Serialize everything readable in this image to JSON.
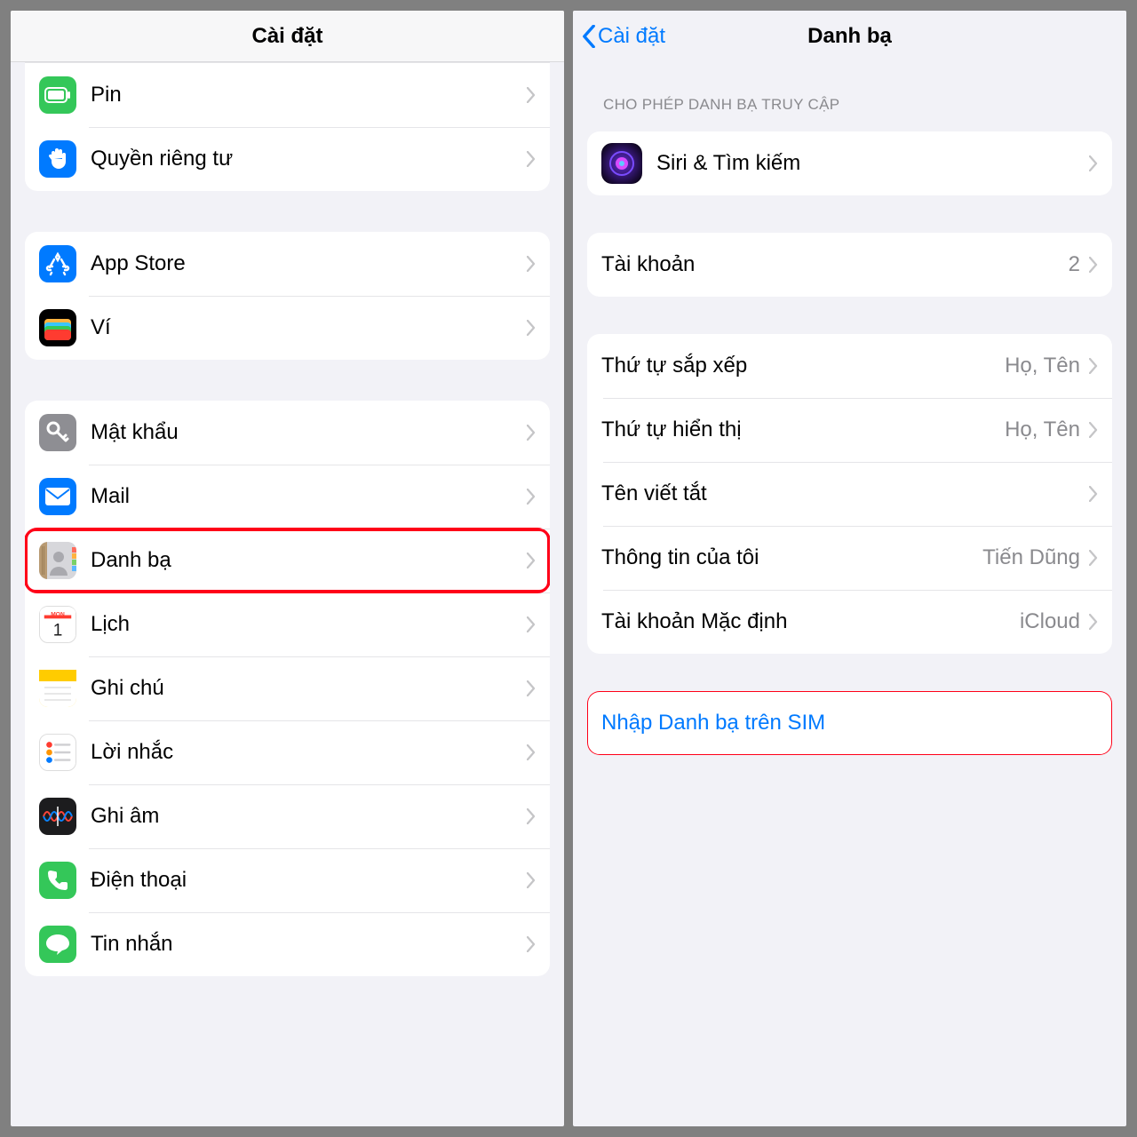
{
  "left": {
    "title": "Cài đặt",
    "groups": [
      {
        "partial": true,
        "items": [
          {
            "key": "battery",
            "icon": "battery-icon",
            "bg": "bg-green",
            "label": "Pin"
          },
          {
            "key": "privacy",
            "icon": "hand-icon",
            "bg": "bg-blue",
            "label": "Quyền riêng tư"
          }
        ]
      },
      {
        "items": [
          {
            "key": "appstore",
            "icon": "appstore-icon",
            "bg": "bg-blue",
            "label": "App Store"
          },
          {
            "key": "wallet",
            "icon": "wallet-icon",
            "bg": "bg-wallet",
            "label": "Ví"
          }
        ]
      },
      {
        "items": [
          {
            "key": "passwords",
            "icon": "key-icon",
            "bg": "bg-gray",
            "label": "Mật khẩu"
          },
          {
            "key": "mail",
            "icon": "mail-icon",
            "bg": "bg-blue",
            "label": "Mail"
          },
          {
            "key": "contacts",
            "icon": "contacts-icon",
            "bg": "bg-contacts",
            "label": "Danh bạ",
            "highlight": true
          },
          {
            "key": "calendar",
            "icon": "calendar-icon",
            "bg": "bg-white-border",
            "label": "Lịch"
          },
          {
            "key": "notes",
            "icon": "notes-icon",
            "bg": "bg-yellow-grad",
            "label": "Ghi chú"
          },
          {
            "key": "reminders",
            "icon": "reminders-icon",
            "bg": "bg-white-border",
            "label": "Lời nhắc"
          },
          {
            "key": "voice",
            "icon": "voice-memos-icon",
            "bg": "bg-dark",
            "label": "Ghi âm"
          },
          {
            "key": "phone",
            "icon": "phone-icon",
            "bg": "bg-green",
            "label": "Điện thoại"
          },
          {
            "key": "messages",
            "icon": "messages-icon",
            "bg": "bg-green",
            "label": "Tin nhắn"
          }
        ]
      }
    ]
  },
  "right": {
    "back": "Cài đặt",
    "title": "Danh bạ",
    "section_header": "CHO PHÉP DANH BẠ TRUY CẬP",
    "siri_label": "Siri & Tìm kiếm",
    "accounts": {
      "label": "Tài khoản",
      "value": "2"
    },
    "prefs": [
      {
        "label": "Thứ tự sắp xếp",
        "value": "Họ, Tên"
      },
      {
        "label": "Thứ tự hiển thị",
        "value": "Họ, Tên"
      },
      {
        "label": "Tên viết tắt",
        "value": ""
      },
      {
        "label": "Thông tin của tôi",
        "value": "Tiến Dũng"
      },
      {
        "label": "Tài khoản Mặc định",
        "value": "iCloud"
      }
    ],
    "import_sim": "Nhập Danh bạ trên SIM"
  }
}
